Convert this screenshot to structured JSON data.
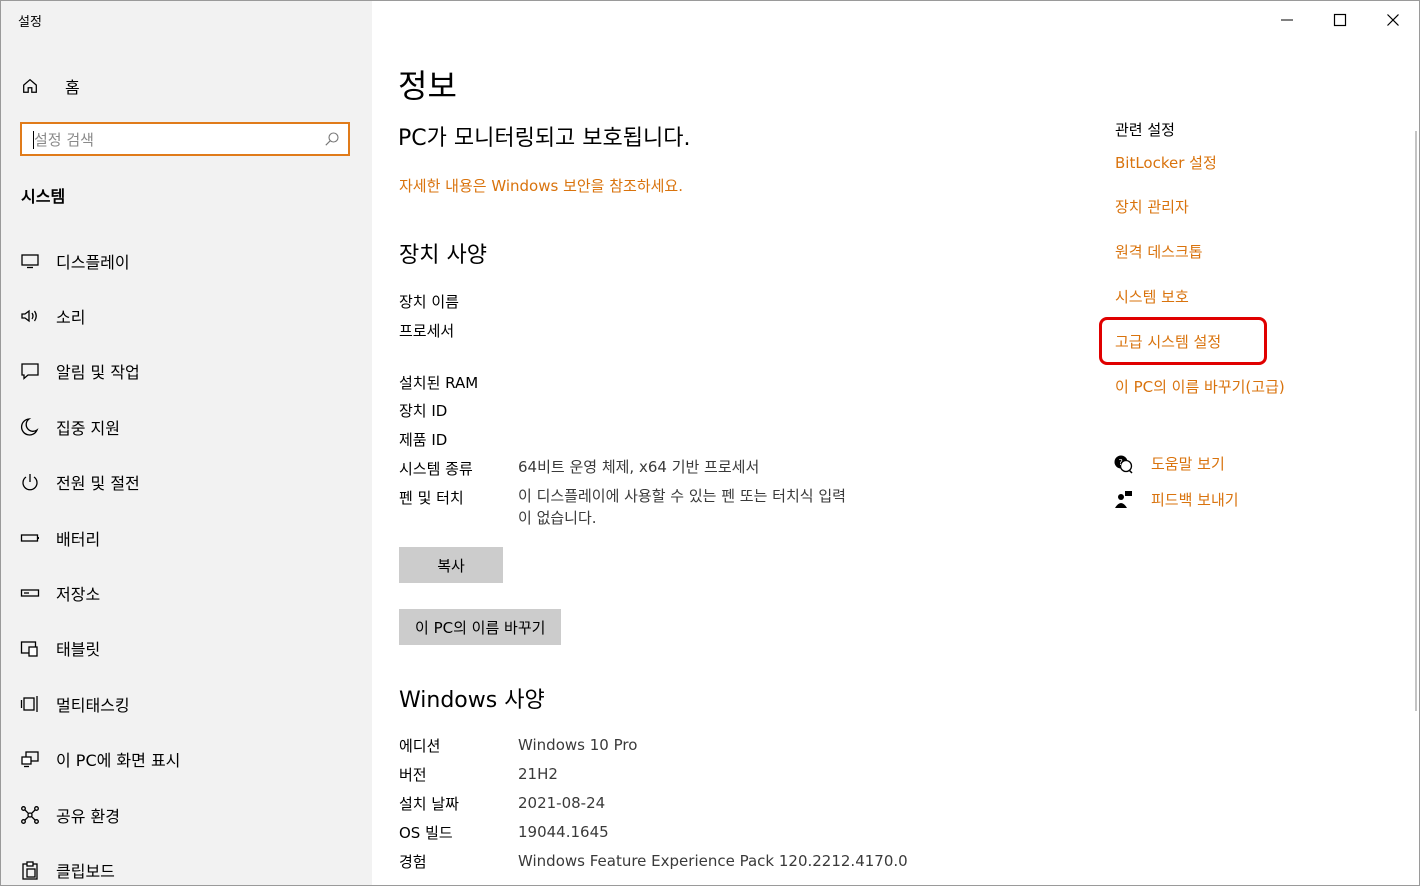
{
  "window": {
    "title": "설정",
    "accent_color": "#d9730d",
    "highlight_color": "#e00000"
  },
  "sidebar": {
    "home_label": "홈",
    "search_placeholder": "설정 검색",
    "section_title": "시스템",
    "items": [
      {
        "label": "디스플레이",
        "icon": "monitor-icon"
      },
      {
        "label": "소리",
        "icon": "speaker-icon"
      },
      {
        "label": "알림 및 작업",
        "icon": "notification-icon"
      },
      {
        "label": "집중 지원",
        "icon": "moon-icon"
      },
      {
        "label": "전원 및 절전",
        "icon": "power-icon"
      },
      {
        "label": "배터리",
        "icon": "battery-icon"
      },
      {
        "label": "저장소",
        "icon": "storage-icon"
      },
      {
        "label": "태블릿",
        "icon": "tablet-icon"
      },
      {
        "label": "멀티태스킹",
        "icon": "multitasking-icon"
      },
      {
        "label": "이 PC에 화면 표시",
        "icon": "project-icon"
      },
      {
        "label": "공유 환경",
        "icon": "share-icon"
      },
      {
        "label": "클립보드",
        "icon": "clipboard-icon"
      }
    ]
  },
  "main": {
    "title": "정보",
    "status": "PC가 모니터링되고 보호됩니다.",
    "security_link": "자세한 내용은 Windows 보안을 참조하세요.",
    "device_specs": {
      "heading": "장치 사양",
      "rows": [
        {
          "label": "장치 이름",
          "value": ""
        },
        {
          "label": "프로세서",
          "value": ""
        },
        {
          "label": "설치된 RAM",
          "value": ""
        },
        {
          "label": "장치 ID",
          "value": ""
        },
        {
          "label": "제품 ID",
          "value": ""
        },
        {
          "label": "시스템 종류",
          "value": "64비트 운영 체제, x64 기반 프로세서"
        },
        {
          "label": "펜 및 터치",
          "value": "이 디스플레이에 사용할 수 있는 펜 또는 터치식 입력\n이 없습니다."
        }
      ]
    },
    "copy_button": "복사",
    "rename_button": "이 PC의 이름 바꾸기",
    "windows_specs": {
      "heading": "Windows 사양",
      "rows": [
        {
          "label": "에디션",
          "value": "Windows 10 Pro"
        },
        {
          "label": "버전",
          "value": "21H2"
        },
        {
          "label": "설치 날짜",
          "value": "2021-08-24"
        },
        {
          "label": "OS 빌드",
          "value": "19044.1645"
        },
        {
          "label": "경험",
          "value": "Windows Feature Experience Pack 120.2212.4170.0"
        }
      ]
    }
  },
  "related": {
    "title": "관련 설정",
    "links": [
      "BitLocker 설정",
      "장치 관리자",
      "원격 데스크톱",
      "시스템 보호",
      "고급 시스템 설정",
      "이 PC의 이름 바꾸기(고급)"
    ],
    "help": "도움말 보기",
    "feedback": "피드백 보내기"
  }
}
